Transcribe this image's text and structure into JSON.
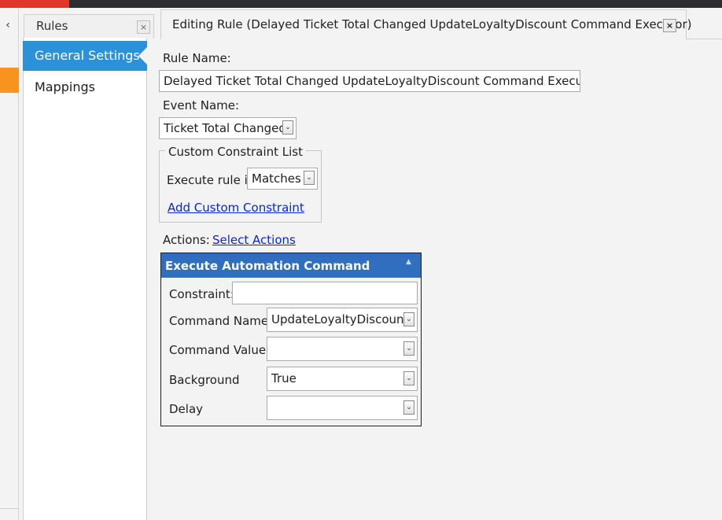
{
  "rules_panel": {
    "tab_label": "Rules",
    "close_glyph": "×",
    "nav_items": [
      "General Settings",
      "Mappings"
    ]
  },
  "left_strip": {
    "collapse_glyph": "‹"
  },
  "editor": {
    "tab_label": "Editing Rule (Delayed Ticket Total Changed UpdateLoyaltyDiscount Command Executor)",
    "close_glyph": "×",
    "rule_name_label": "Rule Name:",
    "rule_name_value": "Delayed Ticket Total Changed UpdateLoyaltyDiscount Command Executor",
    "event_name_label": "Event Name:",
    "event_name_value": "Ticket Total Changed",
    "constraint_group_title": "Custom Constraint List",
    "execute_rule_if_label": "Execute rule if",
    "execute_rule_if_value": "Matches",
    "add_constraint_link": "Add Custom Constraint",
    "actions_label": "Actions:",
    "select_actions_link": "Select Actions"
  },
  "action": {
    "title": "Execute Automation Command",
    "collapse_glyph": "▲",
    "constraint_label": "Constraint:",
    "constraint_value": "",
    "command_name_label": "Command Name",
    "command_name_value": "UpdateLoyaltyDiscount",
    "command_value_label": "Command Value",
    "command_value_value": "",
    "background_label": "Background",
    "background_value": "True",
    "delay_label": "Delay",
    "delay_value": ""
  },
  "dropdown_glyph": "⌄",
  "colors": {
    "accent_blue": "#2b91d9",
    "header_blue": "#2f6fbd",
    "orange": "#f7931e",
    "link": "#0a24e0"
  }
}
